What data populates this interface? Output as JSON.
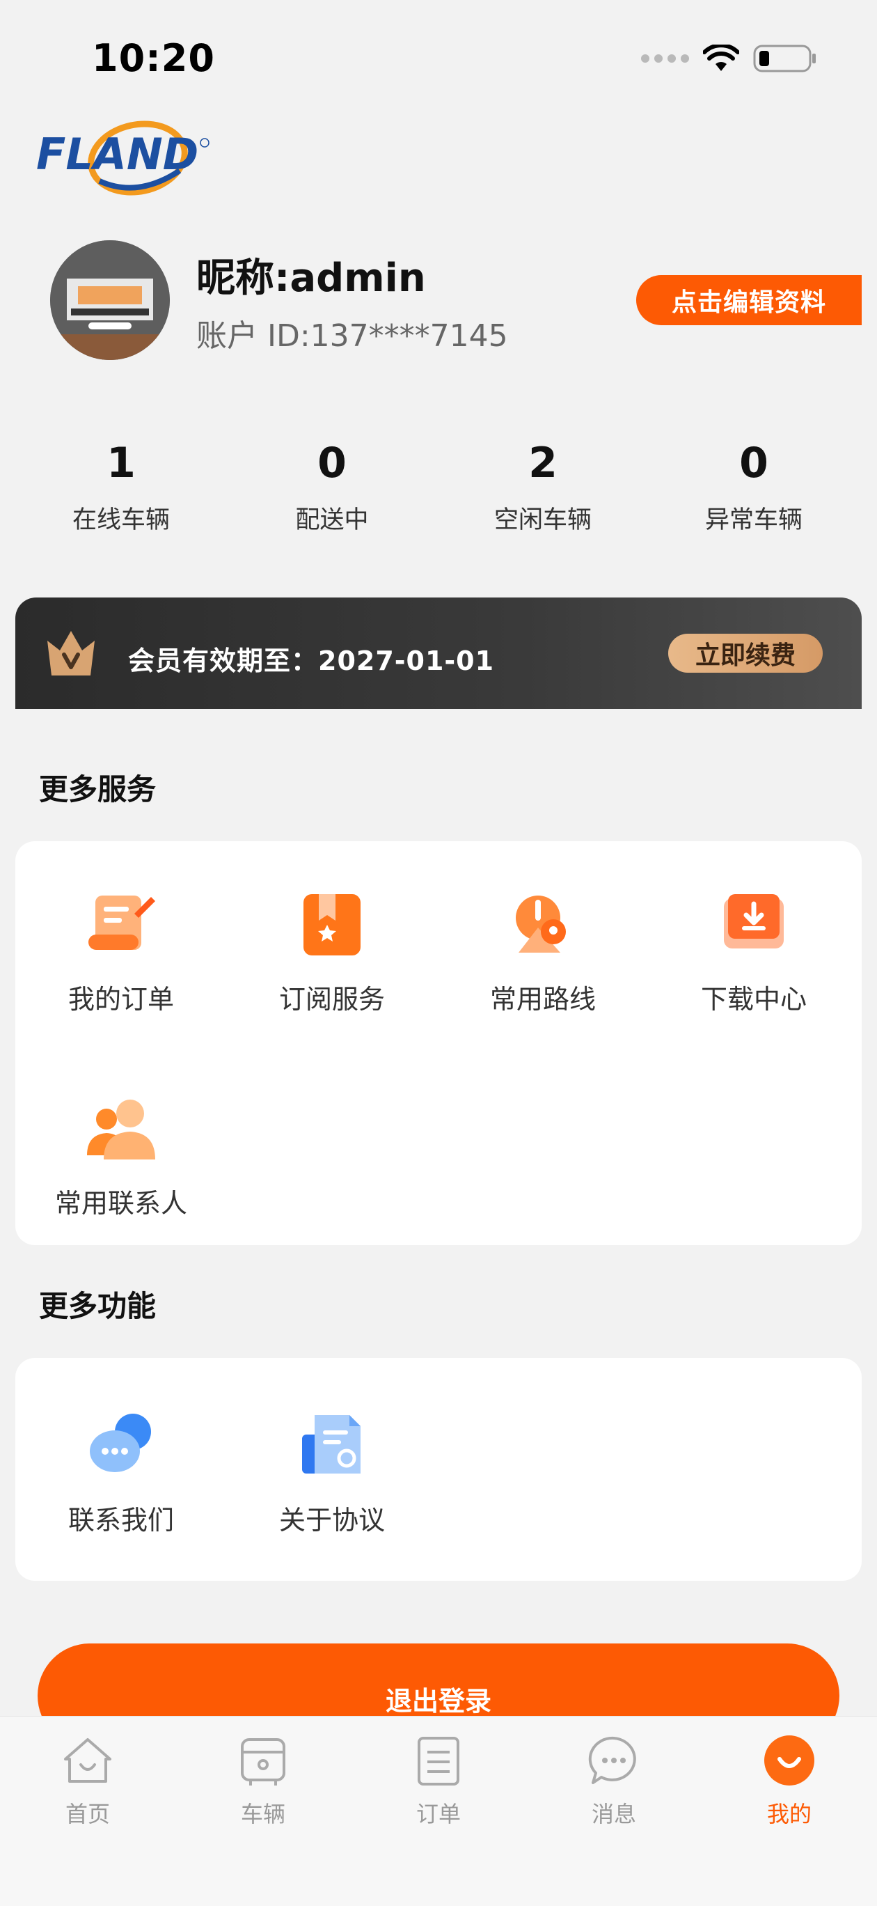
{
  "status_bar": {
    "time": "10:20"
  },
  "brand": {
    "logo_text": "FLAND",
    "accent": "#fd5a04"
  },
  "profile": {
    "nickname": "昵称:admin",
    "account_id": "账户 ID:137****7145",
    "edit_label": "点击编辑资料"
  },
  "stats": [
    {
      "value": "1",
      "label": "在线车辆"
    },
    {
      "value": "0",
      "label": "配送中"
    },
    {
      "value": "2",
      "label": "空闲车辆"
    },
    {
      "value": "0",
      "label": "异常车辆"
    }
  ],
  "vip": {
    "text": "会员有效期至：2027-01-01",
    "renew_label": "立即续费"
  },
  "more_services": {
    "title": "更多服务",
    "items": [
      {
        "label": "我的订单",
        "icon": "order-scroll-icon"
      },
      {
        "label": "订阅服务",
        "icon": "subscription-book-icon"
      },
      {
        "label": "常用路线",
        "icon": "route-pin-icon"
      },
      {
        "label": "下载中心",
        "icon": "download-icon"
      },
      {
        "label": "常用联系人",
        "icon": "contacts-icon"
      }
    ]
  },
  "more_features": {
    "title": "更多功能",
    "items": [
      {
        "label": "联系我们",
        "icon": "chat-bubble-icon"
      },
      {
        "label": "关于协议",
        "icon": "agreement-doc-icon"
      }
    ]
  },
  "logout_label": "退出登录",
  "tabbar": [
    {
      "label": "首页",
      "icon": "home-icon"
    },
    {
      "label": "车辆",
      "icon": "vehicle-icon"
    },
    {
      "label": "订单",
      "icon": "orders-icon"
    },
    {
      "label": "消息",
      "icon": "message-icon"
    },
    {
      "label": "我的",
      "icon": "profile-icon",
      "active": true
    }
  ]
}
